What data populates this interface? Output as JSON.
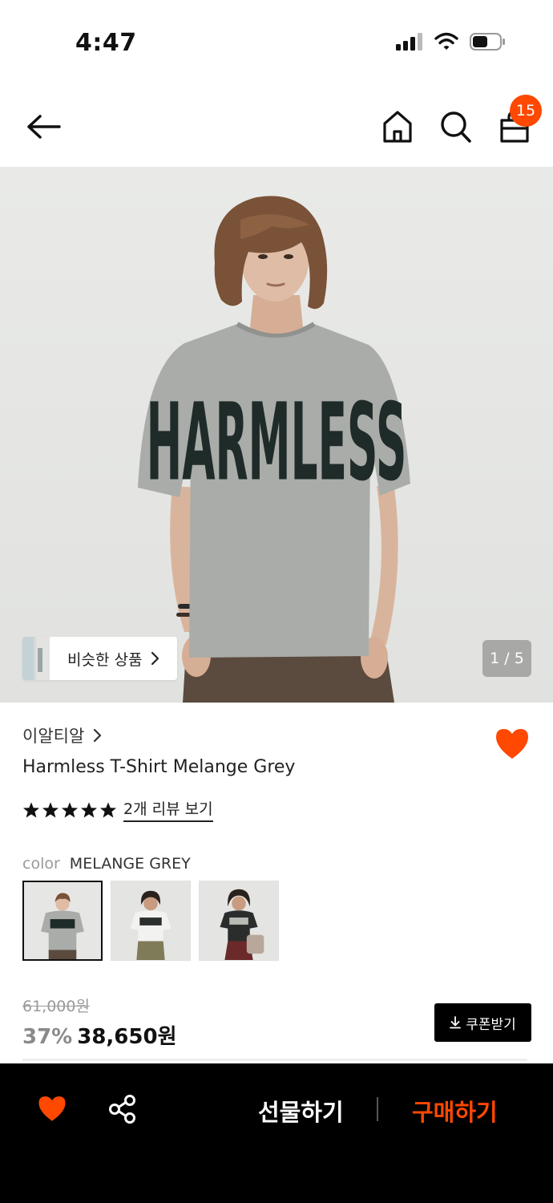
{
  "status_bar": {
    "time": "4:47"
  },
  "header": {
    "cart_count": "15"
  },
  "hero": {
    "shirt_text": "HARMLESS",
    "similar_label": "비슷한 상품",
    "pager": "1 / 5"
  },
  "product": {
    "brand": "이알티알",
    "title": "Harmless T-Shirt Melange Grey",
    "rating_stars": 5,
    "review_link": "2개 리뷰 보기",
    "color_label": "color",
    "color_value": "MELANGE GREY",
    "swatches": [
      {
        "name": "melange-grey",
        "selected": true
      },
      {
        "name": "white",
        "selected": false
      },
      {
        "name": "black",
        "selected": false
      }
    ],
    "original_price": "61,000원",
    "discount": "37%",
    "sale_price": "38,650원",
    "coupon_label": "쿠폰받기"
  },
  "bottom_bar": {
    "gift_label": "선물하기",
    "buy_label": "구매하기"
  },
  "colors": {
    "accent": "#ff4800",
    "bottom_bar_bg": "#000000"
  }
}
